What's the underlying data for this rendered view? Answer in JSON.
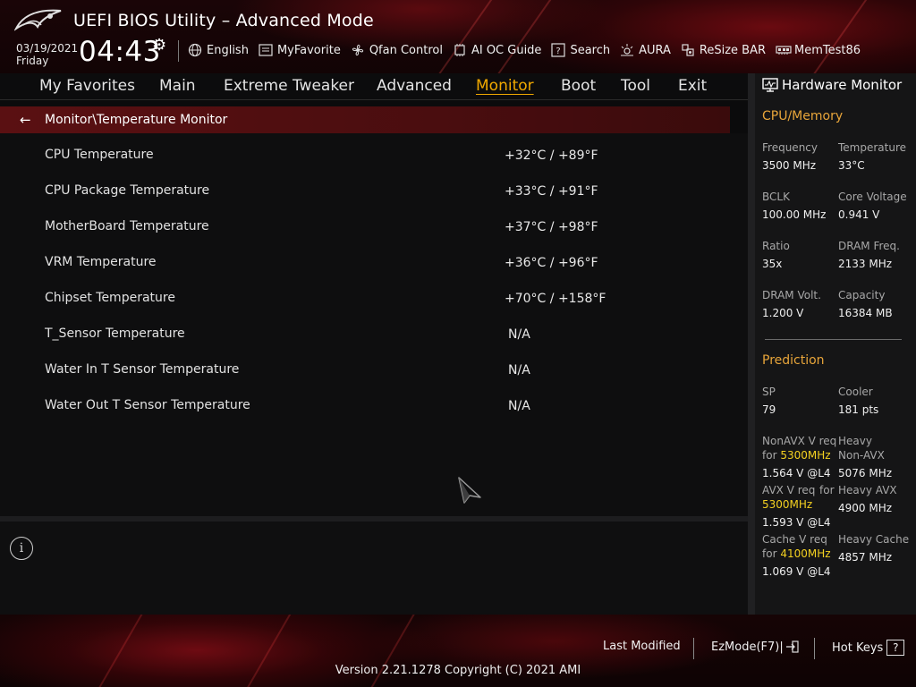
{
  "header": {
    "title": "UEFI BIOS Utility – Advanced Mode",
    "date": "03/19/2021",
    "day": "Friday",
    "time": "04:43",
    "tools": [
      {
        "label": "English",
        "icon": "globe-icon"
      },
      {
        "label": "MyFavorite",
        "icon": "favorite-list-icon"
      },
      {
        "label": "Qfan Control",
        "icon": "fan-icon"
      },
      {
        "label": "AI OC Guide",
        "icon": "ai-chip-icon"
      },
      {
        "label": "Search",
        "icon": "search-question-icon"
      },
      {
        "label": "AURA",
        "icon": "aura-light-icon"
      },
      {
        "label": "ReSize BAR",
        "icon": "resize-bar-icon"
      },
      {
        "label": "MemTest86",
        "icon": "memory-icon"
      }
    ]
  },
  "tabs": [
    {
      "label": "My Favorites",
      "active": false
    },
    {
      "label": "Main",
      "active": false
    },
    {
      "label": "Extreme Tweaker",
      "active": false
    },
    {
      "label": "Advanced",
      "active": false
    },
    {
      "label": "Monitor",
      "active": true
    },
    {
      "label": "Boot",
      "active": false
    },
    {
      "label": "Tool",
      "active": false
    },
    {
      "label": "Exit",
      "active": false
    }
  ],
  "breadcrumb": "Monitor\\Temperature Monitor",
  "rows": [
    {
      "label": "CPU Temperature",
      "value": "+32°C / +89°F"
    },
    {
      "label": "CPU Package Temperature",
      "value": "+33°C / +91°F"
    },
    {
      "label": "MotherBoard Temperature",
      "value": "+37°C / +98°F"
    },
    {
      "label": "VRM Temperature",
      "value": "+36°C / +96°F"
    },
    {
      "label": "Chipset Temperature",
      "value": "+70°C / +158°F"
    },
    {
      "label": "T_Sensor Temperature",
      "value": "N/A"
    },
    {
      "label": "Water In T Sensor Temperature",
      "value": "N/A"
    },
    {
      "label": "Water Out T Sensor Temperature",
      "value": "N/A"
    }
  ],
  "hw": {
    "title": "Hardware Monitor",
    "cpu_section": "CPU/Memory",
    "cpu": [
      {
        "label": "Frequency",
        "value": "3500 MHz"
      },
      {
        "label": "Temperature",
        "value": "33°C"
      },
      {
        "label": "BCLK",
        "value": "100.00 MHz"
      },
      {
        "label": "Core Voltage",
        "value": "0.941 V"
      },
      {
        "label": "Ratio",
        "value": "35x"
      },
      {
        "label": "DRAM Freq.",
        "value": "2133 MHz"
      },
      {
        "label": "DRAM Volt.",
        "value": "1.200 V"
      },
      {
        "label": "Capacity",
        "value": "16384 MB"
      }
    ],
    "prediction_section": "Prediction",
    "sp_label": "SP",
    "sp_value": "79",
    "cooler_label": "Cooler",
    "cooler_value": "181 pts",
    "nonavx_label_1": "NonAVX V req",
    "nonavx_for": "for",
    "nonavx_freq": "5300MHz",
    "nonavx_value": "1.564 V @L4",
    "heavy_nonavx_label_1": "Heavy",
    "heavy_nonavx_label_2": "Non-AVX",
    "heavy_nonavx_value": "5076 MHz",
    "avx_label": "AVX V req",
    "avx_for": "for",
    "avx_freq": "5300MHz",
    "avx_value": "1.593 V @L4",
    "heavy_avx_label": "Heavy AVX",
    "heavy_avx_value": "4900 MHz",
    "cache_label": "Cache V req",
    "cache_for": "for",
    "cache_freq": "4100MHz",
    "cache_value": "1.069 V @L4",
    "heavy_cache_label": "Heavy Cache",
    "heavy_cache_value": "4857 MHz"
  },
  "footer": {
    "last_modified": "Last Modified",
    "ezmode": "EzMode(F7)|",
    "hotkeys": "Hot Keys",
    "hotkeys_key": "?",
    "version": "Version 2.21.1278 Copyright (C) 2021 AMI"
  },
  "colors": {
    "accent": "#f0a800",
    "highlight": "#f3d020",
    "section": "#e8a53a",
    "breadcrumb_bg": "#5a1012"
  }
}
